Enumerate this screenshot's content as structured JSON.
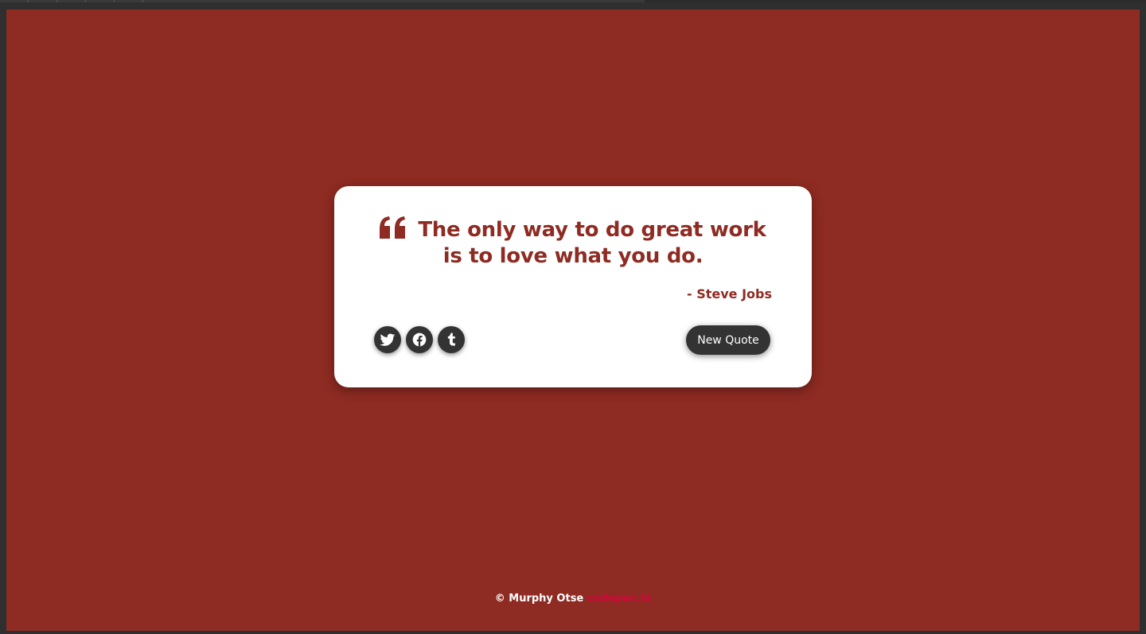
{
  "colors": {
    "accent": "#8e2b22",
    "card_bg": "#ffffff",
    "button_bg": "#333333",
    "footer_link": "#cc0b3a"
  },
  "quote": {
    "icon": "quote-left-icon",
    "text": "The only way to do great work is to love what you do.",
    "author": "- Steve Jobs"
  },
  "share": {
    "buttons": [
      {
        "icon": "twitter-icon"
      },
      {
        "icon": "facebook-icon"
      },
      {
        "icon": "tumblr-icon"
      }
    ]
  },
  "actions": {
    "new_quote_label": "New Quote"
  },
  "footer": {
    "copyright": "© Murphy Otse",
    "link_text": "codepen.io"
  }
}
